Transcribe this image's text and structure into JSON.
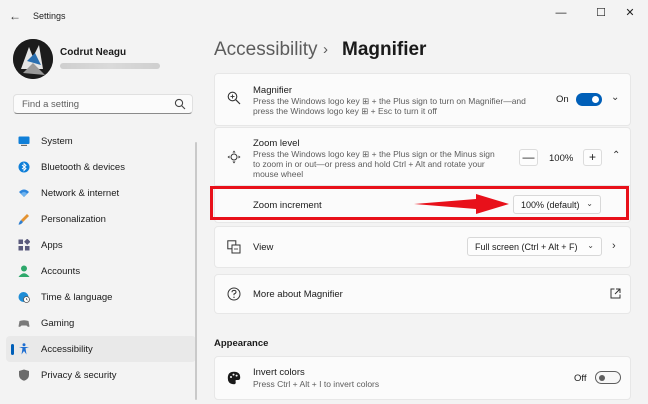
{
  "window": {
    "title": "Settings",
    "back_glyph": "←",
    "minimize_glyph": "—",
    "maximize_glyph": "☐",
    "close_glyph": "✕"
  },
  "profile": {
    "name": "Codrut Neagu"
  },
  "search": {
    "placeholder": "Find a setting"
  },
  "nav": {
    "items": [
      {
        "label": "System",
        "icon": "monitor-icon",
        "color": "#0078d4"
      },
      {
        "label": "Bluetooth & devices",
        "icon": "bluetooth-icon",
        "color": "#0078d4"
      },
      {
        "label": "Network & internet",
        "icon": "wifi-icon",
        "color": "#2d7dd2"
      },
      {
        "label": "Personalization",
        "icon": "brush-icon",
        "color": "#e08a2e"
      },
      {
        "label": "Apps",
        "icon": "apps-icon",
        "color": "#5b5b8a"
      },
      {
        "label": "Accounts",
        "icon": "person-icon",
        "color": "#2ea86b"
      },
      {
        "label": "Time & language",
        "icon": "globe-clock-icon",
        "color": "#1f8dd6"
      },
      {
        "label": "Gaming",
        "icon": "gamepad-icon",
        "color": "#7b7b7b"
      },
      {
        "label": "Accessibility",
        "icon": "accessibility-icon",
        "color": "#1f6fd1",
        "active": true
      },
      {
        "label": "Privacy & security",
        "icon": "shield-icon",
        "color": "#6b6b6b"
      }
    ]
  },
  "header": {
    "parent": "Accessibility",
    "separator": "›",
    "current": "Magnifier"
  },
  "magnifier": {
    "title": "Magnifier",
    "description": "Press the Windows logo key ⊞ + the Plus sign to turn on Magnifier—and press the Windows logo key ⊞ + Esc to turn it off",
    "toggle_label": "On",
    "toggle_state": "on"
  },
  "zoom_level": {
    "title": "Zoom level",
    "description": "Press the Windows logo key ⊞ + the Plus sign or the Minus sign to zoom in or out—or press and hold Ctrl + Alt and rotate your mouse wheel",
    "value": "100%",
    "minus": "—",
    "plus": "+"
  },
  "zoom_increment": {
    "title": "Zoom increment",
    "value": "100% (default)"
  },
  "view": {
    "title": "View",
    "value": "Full screen (Ctrl + Alt + F)"
  },
  "more_about": {
    "title": "More about Magnifier"
  },
  "appearance": {
    "section_title": "Appearance",
    "invert_colors": {
      "title": "Invert colors",
      "description": "Press Ctrl + Alt + I to invert colors",
      "toggle_label": "Off",
      "toggle_state": "off"
    }
  },
  "colors": {
    "accent": "#005fb8",
    "highlight": "#e8101a"
  }
}
